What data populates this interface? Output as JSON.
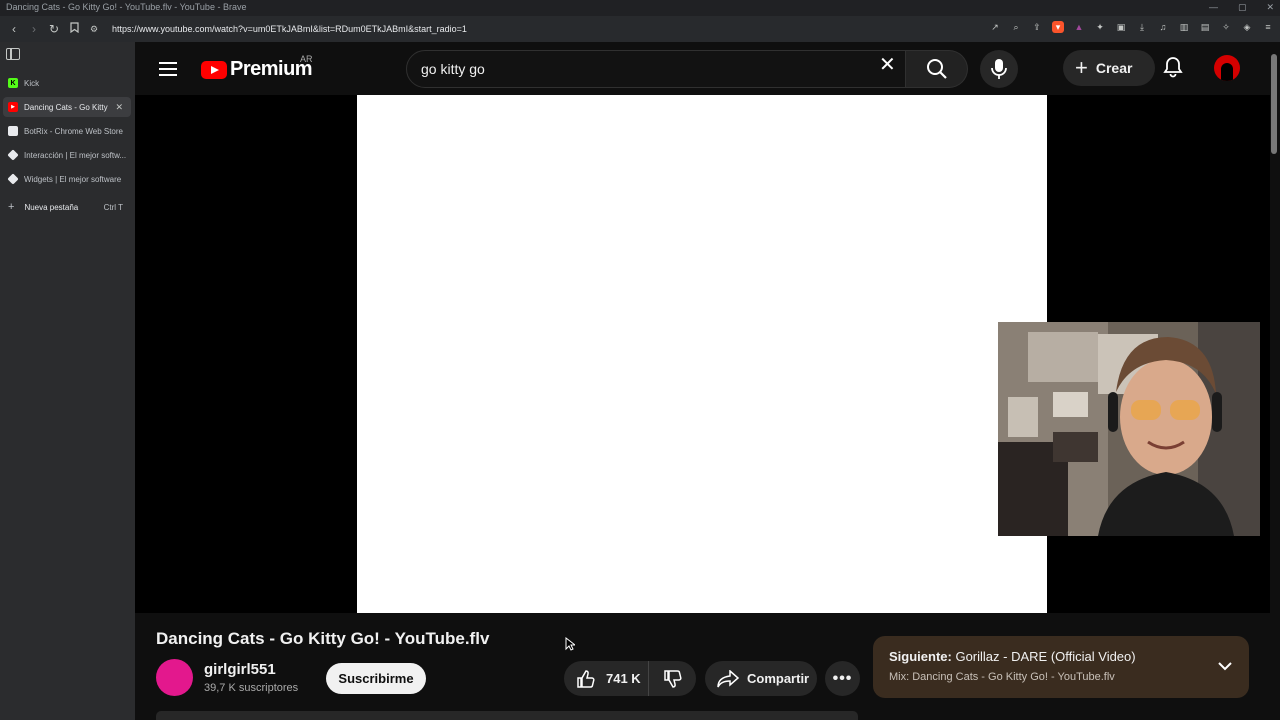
{
  "browser": {
    "window_title": "Dancing Cats - Go Kitty Go! - YouTube.flv - YouTube - Brave",
    "url": "https://www.youtube.com/watch?v=um0ETkJABmI&list=RDum0ETkJABmI&start_radio=1",
    "tabs": [
      {
        "label": "Kick",
        "favicon_color": "#53fc18",
        "favicon_text": "K"
      },
      {
        "label": "Dancing Cats - Go Kitty",
        "favicon_color": "#ff0000",
        "favicon_text": "▶",
        "active": true
      },
      {
        "label": "BotRix - Chrome Web Store",
        "favicon_color": "#e8eaed",
        "favicon_text": ""
      },
      {
        "label": "Interacción | El mejor softw...",
        "favicon_color": "#e8eaed",
        "favicon_text": ""
      },
      {
        "label": "Widgets | El mejor software",
        "favicon_color": "#e8eaed",
        "favicon_text": ""
      }
    ],
    "new_tab_label": "Nueva pestaña",
    "new_tab_shortcut": "Ctrl  T"
  },
  "youtube": {
    "logo_text": "Premium",
    "country_code": "AR",
    "search_query": "go kitty go",
    "create_label": "Crear",
    "video": {
      "title": "Dancing Cats - Go Kitty Go! - YouTube.flv",
      "channel_name": "girlgirl551",
      "subscribers": "39,7 K suscriptores",
      "subscribe_label": "Suscribirme",
      "likes": "741 K",
      "share_label": "Compartir"
    },
    "up_next": {
      "prefix": "Siguiente:",
      "title": "Gorillaz - DARE (Official Video)",
      "mix": "Mix: Dancing Cats - Go Kitty Go! - YouTube.flv"
    }
  },
  "colors": {
    "accent_red": "#ff0000",
    "channel_avatar": "#e3188d",
    "up_next_bg": "#3a2c1f"
  }
}
